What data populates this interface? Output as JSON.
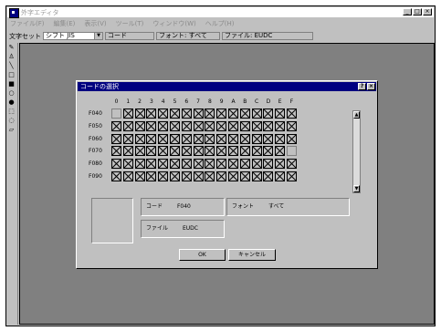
{
  "app": {
    "title": "外字エディタ",
    "caption_buttons": [
      "_",
      "□",
      "×"
    ]
  },
  "menu": [
    "ファイル(F)",
    "編集(E)",
    "表示(V)",
    "ツール(T)",
    "ウィンドウ(W)",
    "ヘルプ(H)"
  ],
  "toolbar": {
    "charset_label": "文字セット",
    "charset_value": "シフト JIS",
    "code_label": "コード",
    "font_label": "フォント: すべて",
    "file_label": "ファイル: EUDC"
  },
  "tools": [
    "pencil-icon",
    "brush-icon",
    "line-icon",
    "hollow-rect-icon",
    "filled-rect-icon",
    "hollow-ellipse-icon",
    "filled-ellipse-icon",
    "select-rect-icon",
    "freeform-select-icon",
    "eraser-icon"
  ],
  "dialog": {
    "title": "コードの選択",
    "help_btn": "?",
    "close_btn": "×",
    "columns": [
      "0",
      "1",
      "2",
      "3",
      "4",
      "5",
      "6",
      "7",
      "8",
      "9",
      "A",
      "B",
      "C",
      "D",
      "E",
      "F"
    ],
    "rows": [
      {
        "code": "F040",
        "empty": [
          0
        ]
      },
      {
        "code": "F050",
        "empty": []
      },
      {
        "code": "F060",
        "empty": []
      },
      {
        "code": "F070",
        "empty": [
          15
        ]
      },
      {
        "code": "F080",
        "empty": []
      },
      {
        "code": "F090",
        "empty": []
      }
    ],
    "info": {
      "code_label": "コード",
      "code_value": "F040",
      "font_label": "フォント",
      "font_value": "すべて",
      "file_label": "ファイル",
      "file_value": "EUDC"
    },
    "ok_label": "OK",
    "cancel_label": "キャンセル"
  },
  "colors": {
    "title_active": "#000080",
    "face": "#c0c0c0",
    "mdi_bg": "#808080"
  }
}
